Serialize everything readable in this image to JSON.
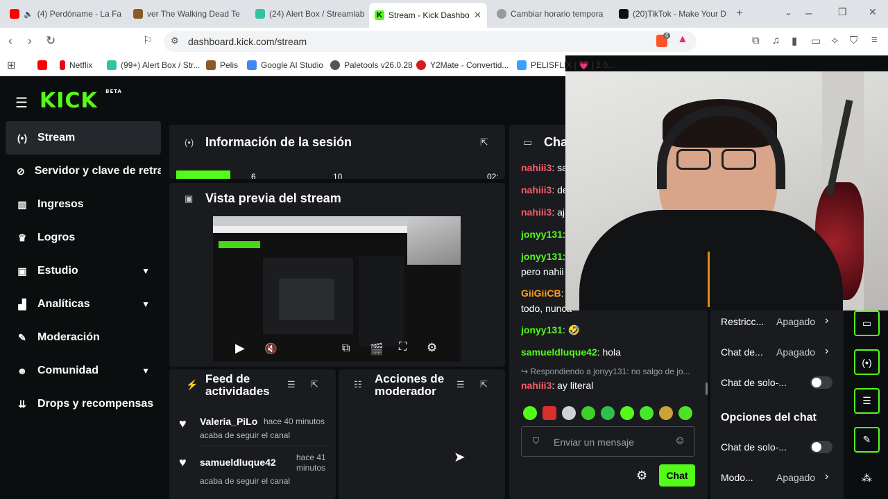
{
  "tabs": [
    {
      "label": "(4) Perdóname - La Fa",
      "color": "#ff0000"
    },
    {
      "label": "ver The Walking Dead Te",
      "color": "#8b5a2b"
    },
    {
      "label": "(24) Alert Box / Streamlab",
      "color": "#31c3a2"
    },
    {
      "label": "Stream - Kick Dashbo",
      "color": "#53fc18"
    },
    {
      "label": "Cambiar horario tempora",
      "color": "#999999"
    },
    {
      "label": "(20)TikTok - Make Your D",
      "color": "#111111"
    }
  ],
  "url": "dashboard.kick.com/stream",
  "brave_badge": "6",
  "bookmarks": [
    {
      "label": "Netflix",
      "color": "#e50914"
    },
    {
      "label": "(99+) Alert Box / Str...",
      "color": "#31c3a2"
    },
    {
      "label": "Pelis",
      "color": "#8b5a2b"
    },
    {
      "label": "Google AI Studio",
      "color": "#4285f4"
    },
    {
      "label": "Paletools v26.0.28",
      "color": "#555555"
    },
    {
      "label": "Y2Mate - Convertid...",
      "color": "#d81b1b"
    },
    {
      "label": "PELISFLIX [ 💗 ] 2.0...",
      "color": "#3aa0ff"
    }
  ],
  "logo": {
    "text": "KICK",
    "beta": "BETA"
  },
  "sidebar": [
    {
      "label": "Stream",
      "icon": "(•)",
      "active": true,
      "chevron": false
    },
    {
      "label": "Servidor y clave de retransmisión",
      "icon": "⊘",
      "active": false,
      "chevron": false
    },
    {
      "label": "Ingresos",
      "icon": "▥",
      "active": false,
      "chevron": false
    },
    {
      "label": "Logros",
      "icon": "🏆",
      "active": false,
      "chevron": false
    },
    {
      "label": "Estudio",
      "icon": "▣",
      "active": false,
      "chevron": true
    },
    {
      "label": "Analíticas",
      "icon": "▲",
      "active": false,
      "chevron": true
    },
    {
      "label": "Moderación",
      "icon": "🔧",
      "active": false,
      "chevron": false
    },
    {
      "label": "Comunidad",
      "icon": "👥",
      "active": false,
      "chevron": true
    },
    {
      "label": "Drops y recompensas",
      "icon": "⬇",
      "active": false,
      "chevron": false
    }
  ],
  "session": {
    "title": "Información de la sesión",
    "stats": [
      "6",
      "10",
      "02:"
    ]
  },
  "preview": {
    "title": "Vista previa del stream"
  },
  "feed": {
    "title_line1": "Feed de",
    "title_line2": "actividades",
    "items": [
      {
        "user": "Valeria_PiLo",
        "time": "hace 40 minutos",
        "action": "acaba de seguir el canal"
      },
      {
        "user": "samueldluque42",
        "time_line1": "hace 41",
        "time_line2": "minutos",
        "action": "acaba de seguir el canal"
      }
    ]
  },
  "modactions": {
    "title_line1": "Acciones de",
    "title_line2": "moderador"
  },
  "chat": {
    "title": "Chat",
    "messages": [
      {
        "user": "nahiii3",
        "text": "sa",
        "color": "r"
      },
      {
        "user": "nahiii3",
        "text": "de",
        "color": "r"
      },
      {
        "user": "nahiii3",
        "text": "aja",
        "color": "r"
      },
      {
        "user": "jonyy131",
        "text": "",
        "color": "g"
      },
      {
        "user": "jonyy131",
        "text": "",
        "color": "g"
      },
      {
        "user": "",
        "text": "pero nahii",
        "color": "w"
      },
      {
        "user": "GiiGiiCB",
        "text": "i",
        "color": "o"
      },
      {
        "user": "",
        "text": "todo, nunca",
        "color": "w"
      },
      {
        "user": "jonyy131",
        "text": "🤣",
        "color": "g"
      },
      {
        "user": "samueldluque42",
        "text": "hola",
        "color": "g"
      }
    ],
    "reply_note": "↪ Respondiendo a jonyy131: no salgo de jo...",
    "last": {
      "user": "nahiii3",
      "text": "ay literal"
    },
    "input_placeholder": "Enviar un mensaje",
    "send_label": "Chat"
  },
  "settings": [
    {
      "label": "Restricc...",
      "value": "Apagado",
      "type": "arrow"
    },
    {
      "label": "Chat de...",
      "value": "Apagado",
      "type": "arrow"
    },
    {
      "label": "Chat de solo-...",
      "value": "",
      "type": "toggle"
    }
  ],
  "chat_options": {
    "title": "Opciones del chat",
    "rows": [
      {
        "label": "Chat de solo-...",
        "value": "",
        "type": "toggle"
      },
      {
        "label": "Modo...",
        "value": "Apagado",
        "type": "arrow"
      }
    ]
  },
  "colors": {
    "accent": "#53fc18",
    "panel": "#191b1f",
    "bg": "#0b0e0f"
  }
}
